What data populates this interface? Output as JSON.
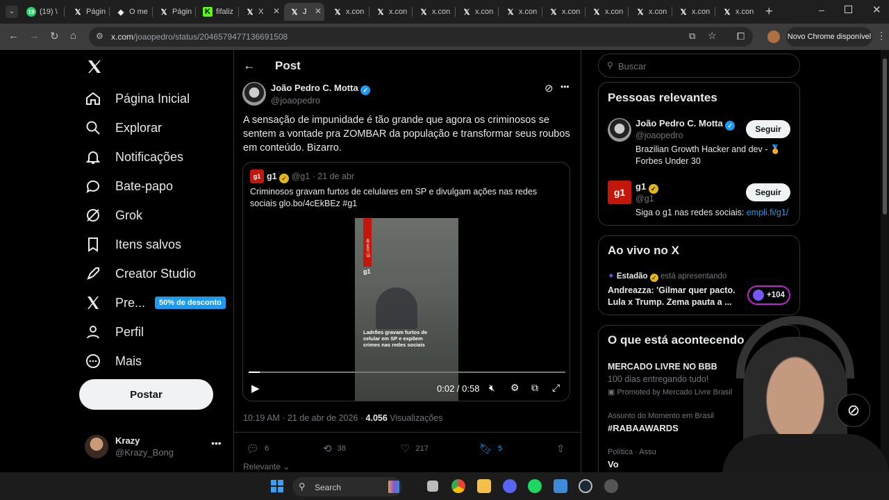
{
  "browser": {
    "tabs": [
      {
        "label": "(19) \\",
        "favicon": "whatsapp-icon"
      },
      {
        "label": "Págin",
        "favicon": "x-icon"
      },
      {
        "label": "O me",
        "favicon": "github-icon"
      },
      {
        "label": "Págin",
        "favicon": "x-icon"
      },
      {
        "label": "fifaliz",
        "favicon": "kick-icon"
      },
      {
        "label": "X",
        "favicon": "x-icon"
      },
      {
        "label": "J",
        "favicon": "x-icon"
      },
      {
        "label": "x.con",
        "favicon": "x-icon"
      },
      {
        "label": "x.con",
        "favicon": "x-icon"
      },
      {
        "label": "x.con",
        "favicon": "x-icon"
      },
      {
        "label": "x.con",
        "favicon": "x-icon"
      },
      {
        "label": "x.con",
        "favicon": "x-icon"
      },
      {
        "label": "x.con",
        "favicon": "x-icon"
      },
      {
        "label": "x.con",
        "favicon": "x-icon"
      },
      {
        "label": "x.con",
        "favicon": "x-icon"
      },
      {
        "label": "x.con",
        "favicon": "x-icon"
      },
      {
        "label": "x.con",
        "favicon": "x-icon"
      }
    ],
    "url_host": "x.com",
    "url_path": "/joaopedro/status/2046579477136691508",
    "update_button": "Novo Chrome disponível"
  },
  "sidebar": {
    "items": [
      {
        "label": "Página Inicial",
        "icon": "home-icon"
      },
      {
        "label": "Explorar",
        "icon": "search-icon"
      },
      {
        "label": "Notificações",
        "icon": "bell-icon"
      },
      {
        "label": "Bate-papo",
        "icon": "chat-icon"
      },
      {
        "label": "Grok",
        "icon": "grok-icon"
      },
      {
        "label": "Itens salvos",
        "icon": "bookmark-icon"
      },
      {
        "label": "Creator Studio",
        "icon": "rocket-icon"
      },
      {
        "label": "Pre...",
        "icon": "x-logo-icon"
      },
      {
        "label": "Perfil",
        "icon": "person-icon"
      },
      {
        "label": "Mais",
        "icon": "more-circle-icon"
      }
    ],
    "premium_badge": "50% de desconto",
    "post_button": "Postar",
    "account": {
      "name": "Krazy",
      "handle": "@Krazy_Bong"
    }
  },
  "post": {
    "header": "Post",
    "author": {
      "name": "João Pedro C. Motta",
      "handle": "@joaopedro"
    },
    "text": "A sensação de impunidade é tão grande que agora os criminosos se sentem a vontade pra ZOMBAR da população e transformar seus roubos em conteúdo. Bizarro.",
    "quote": {
      "name": "g1",
      "handle": "@g1",
      "date": "· 21 de abr",
      "text": "Criminosos gravam furtos de celulares em SP e divulgam ações nas redes sociais glo.bo/4cEkBEz #g1",
      "video_caption": "Ladrões gravam furtos de celular em SP e expõem crimes nas redes sociais",
      "video_watermark": "g1",
      "video_side_text": "g1.com.br",
      "time": "0:02 / 0:58",
      "progress": 0.034
    },
    "meta_time": "10:19 AM · 21 de abr de 2026 ·",
    "views_count": "4.056",
    "views_label": "Visualizações",
    "actions": {
      "replies": "6",
      "reposts": "38",
      "likes": "217",
      "bookmarks": "5"
    },
    "sort_label": "Relevante"
  },
  "right": {
    "search_placeholder": "Buscar",
    "relevant": {
      "title": "Pessoas relevantes",
      "people": [
        {
          "name": "João Pedro C. Motta",
          "handle": "@joaopedro",
          "bio": "Brazilian Growth Hacker and dev - 🏅 Forbes Under 30",
          "button": "Seguir"
        },
        {
          "name": "g1",
          "handle": "@g1",
          "bio": "Siga o g1 nas redes sociais: ",
          "link": "empli.fi/g1/",
          "button": "Seguir"
        }
      ]
    },
    "live": {
      "title": "Ao vivo no X",
      "host": "Estadão",
      "host_action": "está apresentando",
      "text": "Andreazza: 'Gilmar quer pacto. Lula x Trump. Zema pauta a ...",
      "count": "+104"
    },
    "trends": {
      "title": "O que está acontecendo",
      "items": [
        {
          "title": "MERCADO LIVRE NO BBB",
          "sub": "100 dias entregando tudo!",
          "promo": "Promoted by Mercado Livre Brasil"
        },
        {
          "context": "Assunto do Momento em Brasil",
          "title": "#RABAAWARDS"
        },
        {
          "context": "Política · Assu",
          "title": "Vo"
        }
      ]
    }
  },
  "taskbar": {
    "search": "Search"
  },
  "colors": {
    "accent": "#1d9bf0",
    "g1_red": "#c4170c",
    "bg": "#000000"
  }
}
